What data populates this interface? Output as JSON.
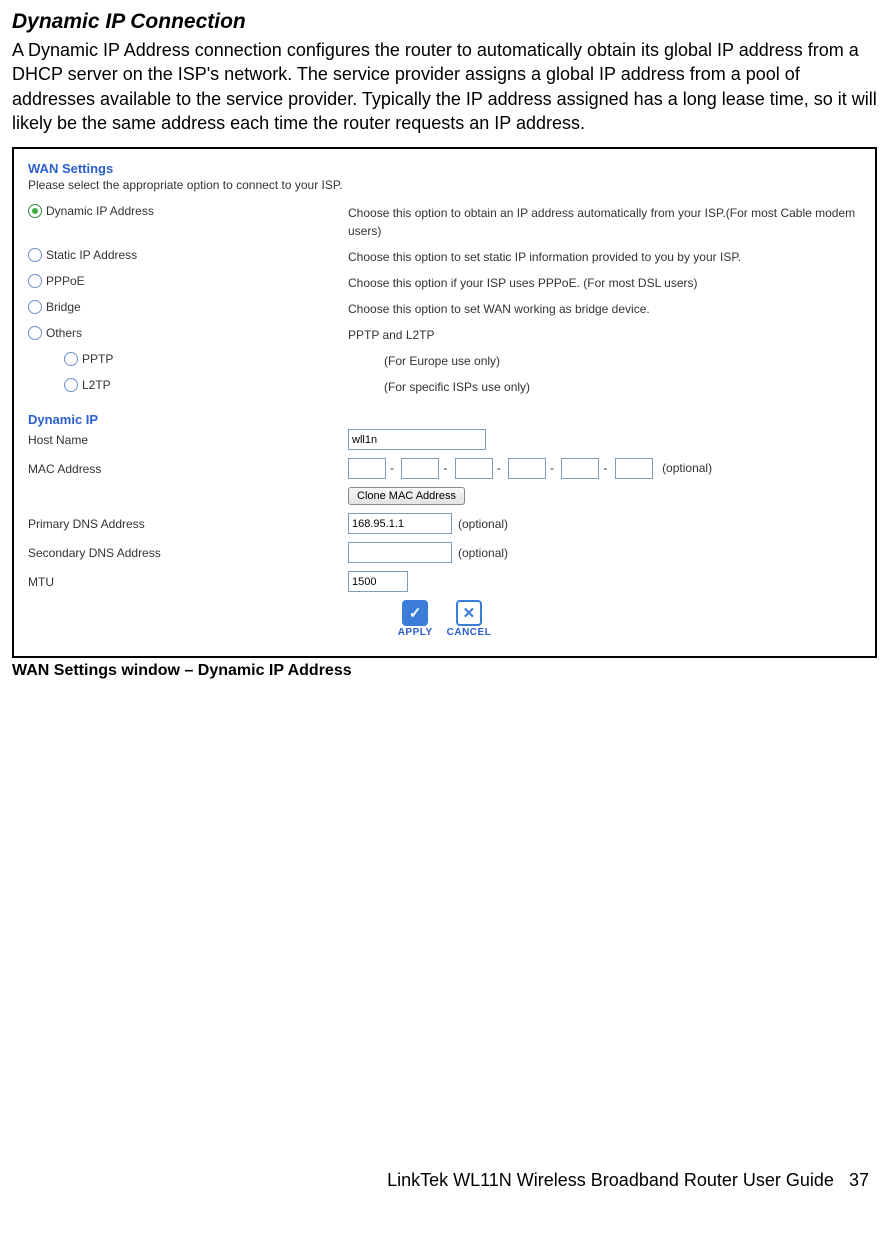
{
  "doc": {
    "title": "Dynamic IP Connection",
    "intro": "A Dynamic IP Address connection configures the router to automatically obtain its global IP address from a DHCP server on the ISP's network. The service provider assigns a global IP address from a pool of addresses available to the service provider. Typically the IP address assigned has a long lease time, so it will likely be the same address each time the router requests an IP address.",
    "caption": "WAN Settings window – Dynamic IP Address",
    "footer_text": "LinkTek WL11N Wireless Broadband Router User Guide",
    "page_number": "37"
  },
  "wan": {
    "heading": "WAN Settings",
    "sub": "Please select the appropriate option to connect to your ISP.",
    "options": {
      "dyn": {
        "label": "Dynamic IP Address",
        "desc": "Choose this option to obtain an IP address automatically from your ISP.(For most Cable modem users)"
      },
      "stat": {
        "label": "Static IP Address",
        "desc": "Choose this option to set static IP information provided to you by your ISP."
      },
      "pppoe": {
        "label": "PPPoE",
        "desc": "Choose this option if your ISP uses PPPoE. (For most DSL users)"
      },
      "bridge": {
        "label": "Bridge",
        "desc": "Choose this option to set WAN working as bridge device."
      },
      "others": {
        "label": "Others",
        "desc": "PPTP and L2TP"
      },
      "pptp": {
        "label": "PPTP",
        "desc": "(For Europe use only)"
      },
      "l2tp": {
        "label": "L2TP",
        "desc": "(For specific ISPs use only)"
      }
    }
  },
  "dyn": {
    "heading": "Dynamic IP",
    "host_label": "Host Name",
    "host_value": "wll1n",
    "mac_label": "MAC Address",
    "mac_optional": "(optional)",
    "clone_label": "Clone MAC Address",
    "dns1_label": "Primary DNS Address",
    "dns1_value": "168.95.1.1",
    "dns1_optional": "(optional)",
    "dns2_label": "Secondary DNS Address",
    "dns2_optional": "(optional)",
    "mtu_label": "MTU",
    "mtu_value": "1500"
  },
  "actions": {
    "apply": "APPLY",
    "cancel": "CANCEL"
  }
}
